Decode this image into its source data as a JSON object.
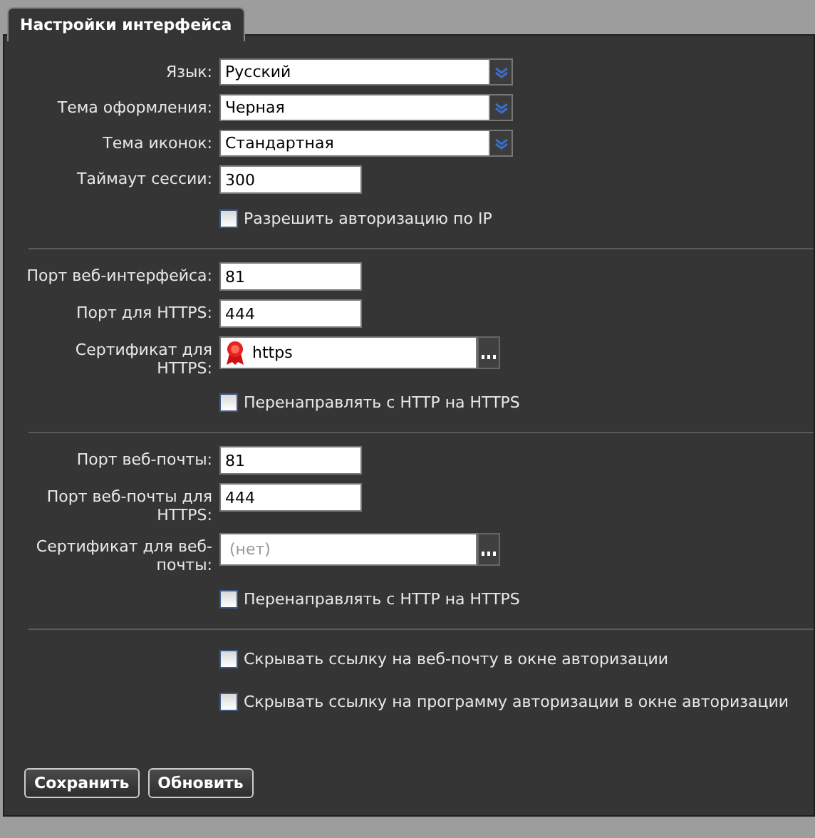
{
  "tabs": [
    {
      "label": "Настройки интерфейса",
      "selected": true
    }
  ],
  "sections": [
    {
      "fields": [
        {
          "kind": "select",
          "label": "Язык:",
          "value": "Русский"
        },
        {
          "kind": "select",
          "label": "Тема оформления:",
          "value": "Черная"
        },
        {
          "kind": "select",
          "label": "Тема иконок:",
          "value": "Стандартная"
        },
        {
          "kind": "text",
          "label": "Таймаут сессии:",
          "value": "300"
        },
        {
          "kind": "checkbox",
          "label": "Разрешить авторизацию по IP",
          "checked": false
        }
      ]
    },
    {
      "fields": [
        {
          "kind": "text",
          "label": "Порт веб-интерфейса:",
          "value": "81"
        },
        {
          "kind": "text",
          "label": "Порт для HTTPS:",
          "value": "444"
        },
        {
          "kind": "certificate",
          "label": "Сертификат для HTTPS:",
          "value": "https"
        },
        {
          "kind": "checkbox",
          "label": "Перенаправлять с HTTP на HTTPS",
          "checked": false
        }
      ]
    },
    {
      "fields": [
        {
          "kind": "text",
          "label": "Порт веб-почты:",
          "value": "81"
        },
        {
          "kind": "text",
          "label": "Порт веб-почты для HTTPS:",
          "value": "444"
        },
        {
          "kind": "certificate",
          "label": "Сертификат для веб-почты:",
          "placeholder": "(нет)"
        },
        {
          "kind": "checkbox",
          "label": "Перенаправлять с HTTP на HTTPS",
          "checked": false
        }
      ]
    },
    {
      "fields": [
        {
          "kind": "checkbox",
          "label": "Скрывать ссылку на веб-почту в окне авторизации",
          "checked": false
        },
        {
          "kind": "checkbox",
          "label": "Скрывать ссылку на программу авторизации в окне авторизации",
          "checked": false
        }
      ]
    }
  ],
  "buttons": [
    "Сохранить",
    "Обновить"
  ]
}
